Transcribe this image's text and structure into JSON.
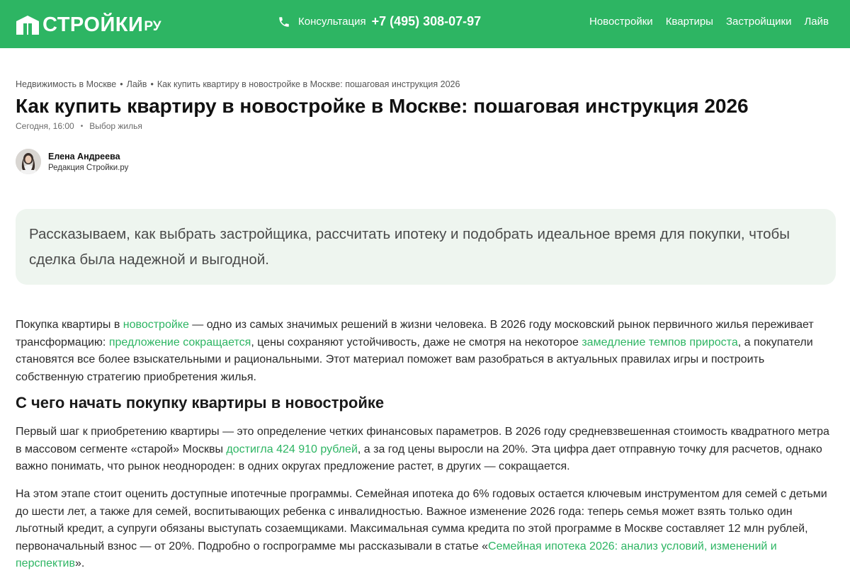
{
  "header": {
    "logo_text": "СТРОЙКИ",
    "logo_suffix": "РУ",
    "consult_label": "Консультация",
    "phone": "+7 (495) 308-07-97",
    "nav": [
      "Новостройки",
      "Квартиры",
      "Застройщики",
      "Лайв"
    ],
    "brand_color": "#2db563"
  },
  "breadcrumb": [
    "Недвижимость в Москве",
    "Лайв",
    "Как купить квартиру в новостройке в Москве: пошаговая инструкция 2026"
  ],
  "breadcrumb_separator": "•",
  "article": {
    "title": "Как купить квартиру в новостройке в Москве: пошаговая инструкция 2026",
    "date": "Сегодня, 16:00",
    "rubric": "Выбор жилья",
    "author_name": "Елена Андреева",
    "author_role": "Редакция Стройки.ру",
    "lead": "Рассказываем, как выбрать застройщика, рассчитать ипотеку и подобрать идеальное время для покупки, чтобы сделка была надежной и выгодной.",
    "p1": {
      "t1": "Покупка квартиры в ",
      "l1": "новостройке",
      "t2": " — одно из самых значимых решений в жизни человека. В 2026 году московский рынок первичного жилья переживает трансформацию: ",
      "l2": "предложение сокращается",
      "t3": ", цены сохраняют устойчивость, даже не смотря на некоторое ",
      "l3": "замедление темпов прироста",
      "t4": ", а покупатели становятся все более взыскательными и рациональными. Этот материал поможет вам разобраться в актуальных правилах игры и построить собственную стратегию приобретения жилья."
    },
    "h2": "С чего начать покупку квартиры в новостройке",
    "p2": {
      "t1": "Первый шаг к приобретению квартиры — это определение четких финансовых параметров. В 2026 году средневзвешенная стоимость квадратного метра в массовом сегменте «старой» Москвы ",
      "l1": "достигла 424 910 рублей",
      "t2": ", а за год цены выросли на 20%. Эта цифра дает отправную точку для расчетов, однако важно понимать, что рынок неоднороден: в одних округах предложение растет, в других — сокращается."
    },
    "p3": {
      "t1": "На этом этапе стоит оценить доступные ипотечные программы. Семейная ипотека до 6% годовых остается ключевым инструментом для семей с детьми до шести лет, а также для семей, воспитывающих ребенка с инвалидностью. Важное изменение 2026 года: теперь семья может взять только один льготный кредит, а супруги обязаны выступать созаемщиками. Максимальная сумма кредита по этой программе в Москве составляет 12 млн рублей, первоначальный взнос — от 20%. Подробно о госпрограмме мы рассказывали в статье «",
      "l1": "Семейная ипотека 2026: анализ условий, изменений и перспектив",
      "t2": "»."
    }
  }
}
